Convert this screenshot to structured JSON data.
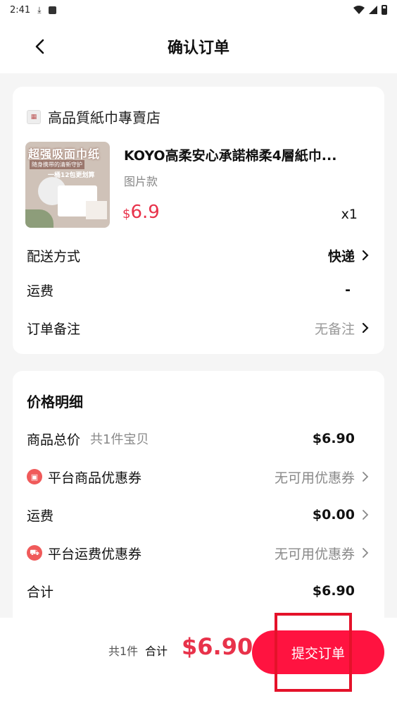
{
  "status": {
    "time": "2:41"
  },
  "header": {
    "title": "确认订单"
  },
  "shop": {
    "name": "高品質紙巾專賣店"
  },
  "product": {
    "image_text_main": "超强吸面巾纸",
    "image_text_sub": "随身携带的清新守护",
    "image_text_promo": "一桶12包更划算",
    "title": "KOYO高柔安心承諾棉柔4層紙巾...",
    "variant": "图片款",
    "currency": "$",
    "price": "6.9",
    "quantity": "x1"
  },
  "order_rows": [
    {
      "label": "配送方式",
      "value": "快递"
    },
    {
      "label": "运费",
      "value": "-"
    },
    {
      "label": "订单备注",
      "value": "无备注"
    }
  ],
  "price_detail": {
    "title": "价格明细",
    "goods_total": {
      "label": "商品总价",
      "sub": "共1件宝贝",
      "value": "$6.90"
    },
    "platform_coupon": {
      "label": "平台商品优惠券",
      "value": "无可用优惠券"
    },
    "shipping": {
      "label": "运费",
      "value": "$0.00"
    },
    "shipping_coupon": {
      "label": "平台运费优惠券",
      "value": "无可用优惠券"
    },
    "total": {
      "label": "合计",
      "value": "$6.90"
    }
  },
  "bottom": {
    "count": "共1件",
    "sum_label": "合计",
    "total": "$6.90",
    "submit": "提交订单"
  },
  "colors": {
    "accent": "#ff1340",
    "price": "#e8324a",
    "highlight": "#e4122a"
  },
  "icons": [
    "download-icon",
    "notification-icon",
    "wifi-icon",
    "signal-icon",
    "battery-icon",
    "back-arrow-icon",
    "shop-icon",
    "chevron-right-icon",
    "coupon-icon",
    "truck-icon"
  ]
}
